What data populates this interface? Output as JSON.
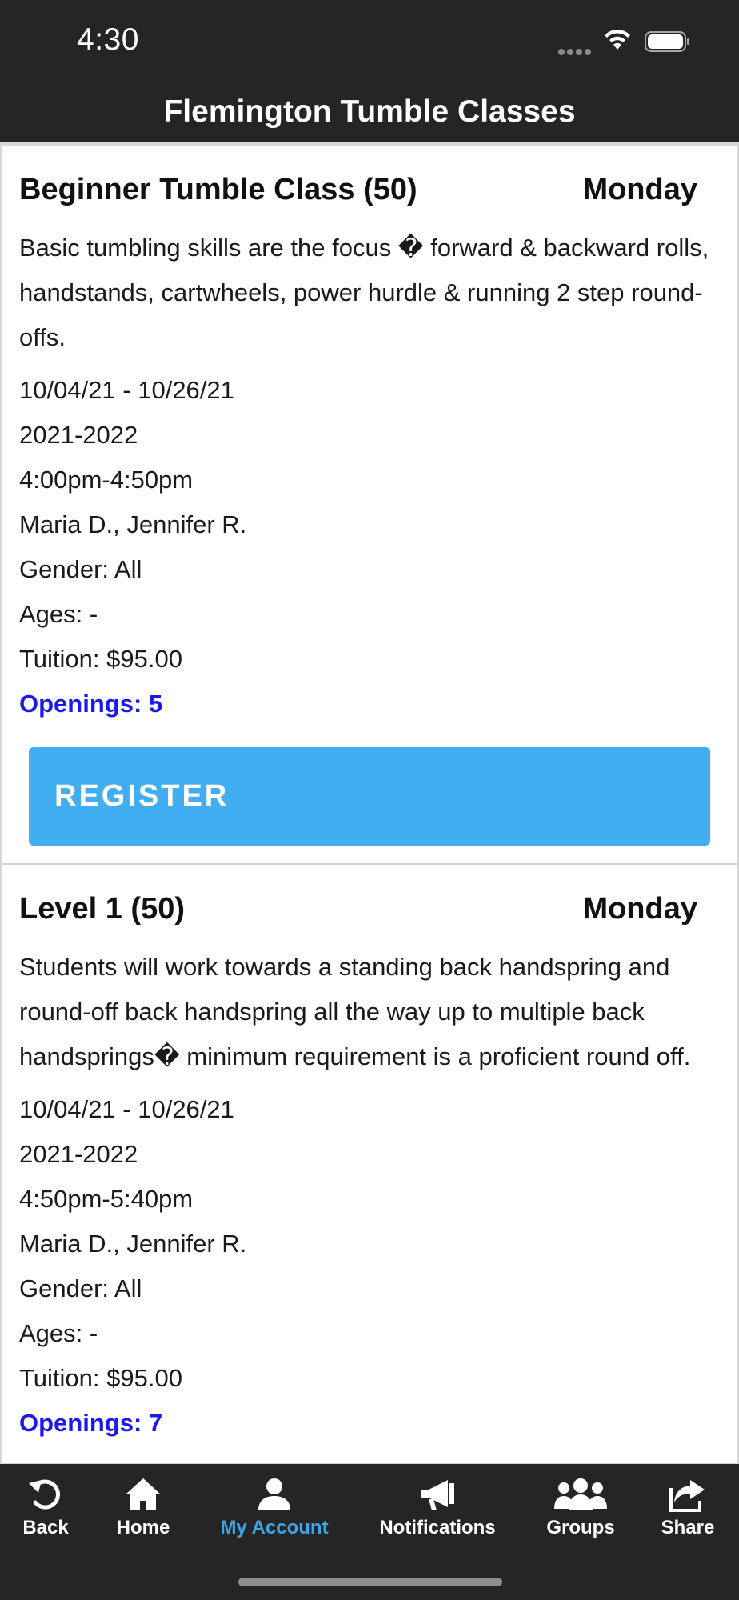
{
  "status_bar": {
    "time": "4:30"
  },
  "header": {
    "title": "Flemington Tumble Classes"
  },
  "classes": [
    {
      "name": "Beginner Tumble Class (50)",
      "day": "Monday",
      "description": "Basic tumbling skills are the focus � forward & backward rolls, handstands, cartwheels, power hurdle & running 2 step round-offs.",
      "dates": "10/04/21 - 10/26/21",
      "season": "2021-2022",
      "time": "4:00pm-4:50pm",
      "instructors": "Maria D., Jennifer R.",
      "gender": "Gender: All",
      "ages": "Ages: -",
      "tuition": "Tuition: $95.00",
      "openings": "Openings: 5",
      "register_label": "REGISTER"
    },
    {
      "name": "Level 1 (50)",
      "day": "Monday",
      "description": "Students will work towards a standing back handspring and round-off back handspring all the way up to multiple back handsprings� minimum requirement is a proficient round off.",
      "dates": "10/04/21 - 10/26/21",
      "season": "2021-2022",
      "time": "4:50pm-5:40pm",
      "instructors": "Maria D., Jennifer R.",
      "gender": "Gender: All",
      "ages": "Ages: -",
      "tuition": "Tuition: $95.00",
      "openings": "Openings: 7"
    }
  ],
  "tab_bar": {
    "items": [
      {
        "label": "Back",
        "icon": "back-arrow-icon"
      },
      {
        "label": "Home",
        "icon": "home-icon"
      },
      {
        "label": "My Account",
        "icon": "person-icon",
        "active": true
      },
      {
        "label": "Notifications",
        "icon": "megaphone-icon"
      },
      {
        "label": "Groups",
        "icon": "group-icon"
      },
      {
        "label": "Share",
        "icon": "share-icon"
      }
    ],
    "active_color": "#3fa3e8"
  },
  "colors": {
    "header_bg": "#252525",
    "register_bg": "#42aef2",
    "openings_text": "#1a1aee"
  }
}
